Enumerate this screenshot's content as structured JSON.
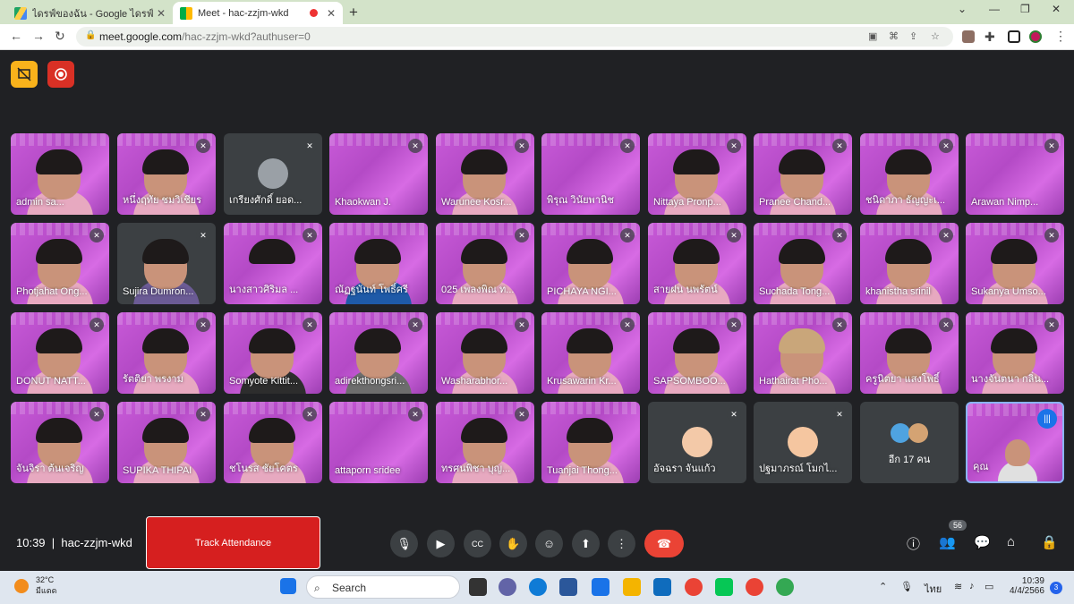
{
  "browser": {
    "tabs": [
      {
        "title": "ไดรฟ์ของฉัน - Google ไดรฟ์"
      },
      {
        "title": "Meet - hac-zzjm-wkd"
      }
    ],
    "url_host": "meet.google.com",
    "url_path": "/hac-zzjm-wkd?authuser=0"
  },
  "participants": [
    {
      "name": "admin sa..."
    },
    {
      "name": "หนึ่งฤทัย ชมวิเชียร"
    },
    {
      "name": "เกรียงศักดิ์ ยอด..."
    },
    {
      "name": "Khaokwan J."
    },
    {
      "name": "Warunee Kosr..."
    },
    {
      "name": "พิรุณ วินัยพานิช"
    },
    {
      "name": "Nittaya Pronp..."
    },
    {
      "name": "Pranee Chand..."
    },
    {
      "name": "ชนิดาภา ธัญญะเ..."
    },
    {
      "name": "Arawan Nimp..."
    },
    {
      "name": "Photjahat Ong..."
    },
    {
      "name": "Sujira Dumron..."
    },
    {
      "name": "นางสาวศิริมล ..."
    },
    {
      "name": "ณัฏฐนันท์ โพธิ์ศรี"
    },
    {
      "name": "025 เพลงพิณ ท..."
    },
    {
      "name": "PICHAYA NGI..."
    },
    {
      "name": "สายฝน นพรัตน์"
    },
    {
      "name": "Suchada Tong..."
    },
    {
      "name": "khanistha srinil"
    },
    {
      "name": "Sukanya Umso..."
    },
    {
      "name": "DONUT NATT..."
    },
    {
      "name": "รัตติยา พรงาม"
    },
    {
      "name": "Somyote Kittit..."
    },
    {
      "name": "adirekthongsri..."
    },
    {
      "name": "Washarabhor..."
    },
    {
      "name": "Krusawarin Kr..."
    },
    {
      "name": "SAPSOMBOO..."
    },
    {
      "name": "Hathairat Pho..."
    },
    {
      "name": "ครูนิตยา แสงโพธิ์"
    },
    {
      "name": "นางจันตนา กลิ่น..."
    },
    {
      "name": "จันจิรา ต้นเจริญ"
    },
    {
      "name": "SUPIKA THIPAI"
    },
    {
      "name": "ชโนรส ชัยโคตร"
    },
    {
      "name": "attaporn sridee"
    },
    {
      "name": "ทรศนพิชา บุญ..."
    },
    {
      "name": "Tuanjai Thong..."
    },
    {
      "name": "อัจฉรา จันแก้ว"
    },
    {
      "name": "ปฐมาภรณ์ โมกไ..."
    }
  ],
  "others_label": "อีก 17 คน",
  "self_label": "คุณ",
  "meeting": {
    "time": "10:39",
    "code": "hac-zzjm-wkd",
    "track_button": "Track Attendance",
    "people_count": "56"
  },
  "taskbar": {
    "temperature": "32°C",
    "weather": "มีแดด",
    "search_placeholder": "Search",
    "lang": "ไทย",
    "time": "10:39",
    "date": "4/4/2566",
    "notifications": "3"
  }
}
